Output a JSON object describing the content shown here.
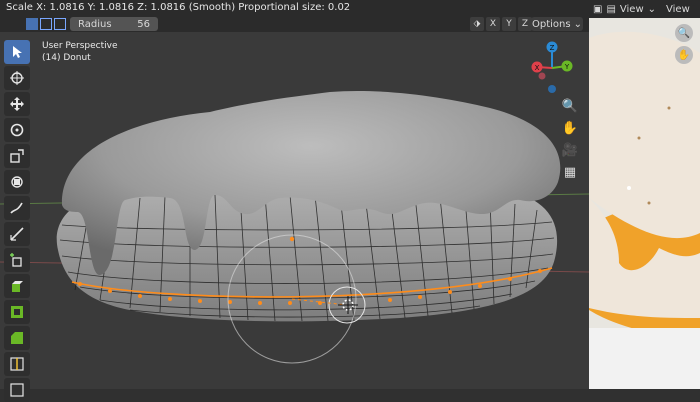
{
  "header": {
    "status": "Scale X: 1.0816   Y: 1.0816   Z: 1.0816 (Smooth) Proportional size: 0.02",
    "radius_label": "Radius",
    "radius_value": "56",
    "axis_x": "X",
    "axis_y": "Y",
    "axis_z": "Z",
    "options_label": "Options"
  },
  "viewport": {
    "perspective_label": "User Perspective",
    "object_label": "(14) Donut"
  },
  "gizmo": {
    "x_label": "X",
    "y_label": "Y",
    "z_label": "Z"
  },
  "image_editor": {
    "view_label": "View",
    "view_label_2": "View"
  },
  "colors": {
    "accent": "#4772b3",
    "selected_vertex": "#ff8c1a",
    "x_axis": "#e0404a",
    "y_axis": "#6ab826",
    "z_axis": "#2a8bd6"
  },
  "icons": [
    "select-icon",
    "cursor-icon",
    "move-icon",
    "rotate-icon",
    "scale-icon",
    "transform-icon",
    "annotate-icon",
    "measure-icon",
    "add-cube-icon",
    "extrude-icon",
    "inset-icon",
    "bevel-icon",
    "loopcut-icon",
    "zoom-icon",
    "hand-icon",
    "camera-icon",
    "grid-icon"
  ]
}
